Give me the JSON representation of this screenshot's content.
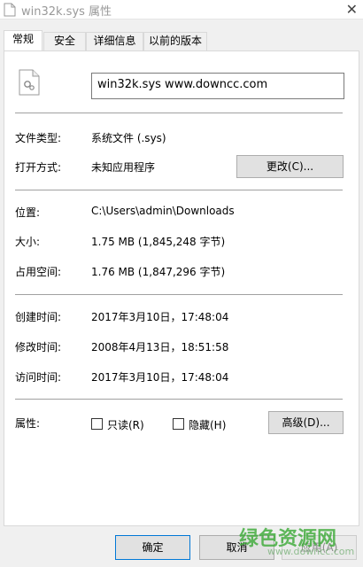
{
  "window": {
    "title": "win32k.sys 属性",
    "close_label": "✕"
  },
  "tabs": [
    {
      "label": "常规",
      "active": true
    },
    {
      "label": "安全",
      "active": false
    },
    {
      "label": "详细信息",
      "active": false
    },
    {
      "label": "以前的版本",
      "active": false
    }
  ],
  "general": {
    "file_name": "win32k.sys    www.downcc.com",
    "type_label": "文件类型:",
    "type_value": "系统文件 (.sys)",
    "open_with_label": "打开方式:",
    "open_with_value": "未知应用程序",
    "change_button": "更改(C)...",
    "location_label": "位置:",
    "location_value": "C:\\Users\\admin\\Downloads",
    "size_label": "大小:",
    "size_value": "1.75 MB (1,845,248 字节)",
    "size_on_disk_label": "占用空间:",
    "size_on_disk_value": "1.76 MB (1,847,296 字节)",
    "created_label": "创建时间:",
    "created_value": "2017年3月10日，17:48:04",
    "modified_label": "修改时间:",
    "modified_value": "2008年4月13日，18:51:58",
    "accessed_label": "访问时间:",
    "accessed_value": "2017年3月10日，17:48:04",
    "attributes_label": "属性:",
    "readonly_label": "只读(R)",
    "readonly_checked": false,
    "hidden_label": "隐藏(H)",
    "hidden_checked": false,
    "advanced_button": "高级(D)..."
  },
  "footer": {
    "ok_button": "确定",
    "cancel_button": "取消",
    "apply_button": "应用(A)"
  },
  "watermark": {
    "text": "绿色资源网",
    "sub": "www.downcc.com"
  }
}
